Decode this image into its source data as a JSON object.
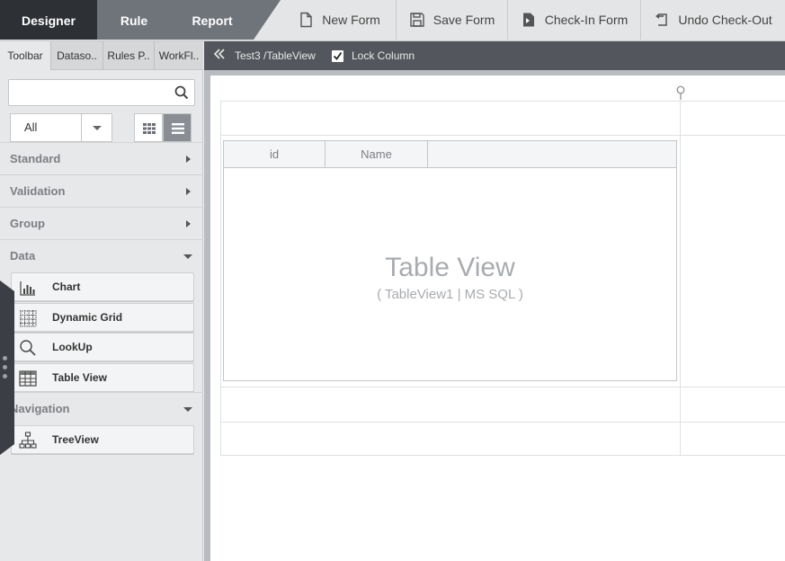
{
  "top_tabs": {
    "designer": "Designer",
    "rule": "Rule",
    "report": "Report"
  },
  "toolbar": {
    "new_form": "New Form",
    "save_form": "Save Form",
    "check_in": "Check-In Form",
    "undo_checkout": "Undo Check-Out"
  },
  "left_tabs": [
    "Toolbar",
    "Dataso..",
    "Rules P..",
    "WorkFl.."
  ],
  "search": {
    "value": "",
    "placeholder": ""
  },
  "filter": {
    "selected": "All"
  },
  "categories": {
    "standard": "Standard",
    "validation": "Validation",
    "group": "Group",
    "data": "Data",
    "navigation": "Navigation"
  },
  "data_items": [
    "Chart",
    "Dynamic Grid",
    "LookUp",
    "Table View"
  ],
  "navigation_items": [
    "TreeView"
  ],
  "breadcrumb": {
    "path": "Test3 /TableView",
    "lock_column_label": "Lock Column",
    "lock_column_checked": true
  },
  "table_view": {
    "columns": [
      "id",
      "Name"
    ],
    "title": "Table View",
    "subtitle": "( TableView1 | MS SQL )"
  },
  "colors": {
    "dark_tab": "#2d3035",
    "inactive_tab": "#6f737a",
    "crumb_bar": "#53575d"
  },
  "icons": [
    "new-form-icon",
    "save-icon",
    "check-in-icon",
    "undo-icon",
    "search-icon",
    "grid-view-icon",
    "list-view-icon",
    "chart-icon",
    "dynamic-grid-icon",
    "lookup-icon",
    "table-view-icon",
    "tree-view-icon",
    "collapse-icon",
    "checkmark-icon",
    "pin-icon"
  ]
}
